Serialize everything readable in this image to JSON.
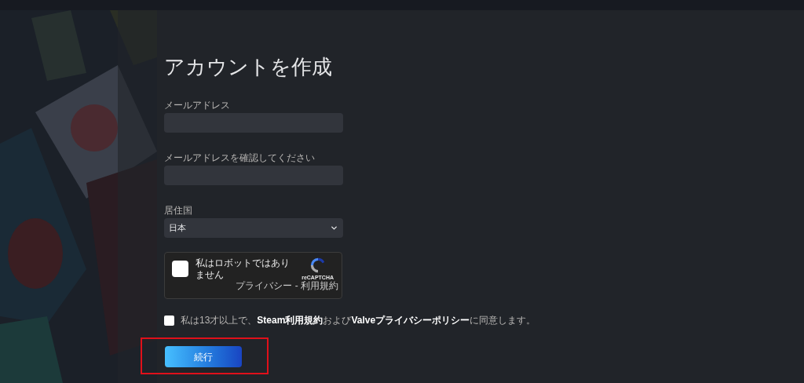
{
  "title": "アカウントを作成",
  "fields": [
    {
      "kind": "text",
      "label": "メールアドレス"
    },
    {
      "kind": "text",
      "label": "メールアドレスを確認してください"
    },
    {
      "kind": "select",
      "label": "居住国",
      "value": "日本"
    }
  ],
  "captcha": {
    "checked": false,
    "label": "私はロボットではありません",
    "brand": "reCAPTCHA",
    "links": "プライバシー - 利用規約"
  },
  "agreement": {
    "checked": false,
    "text": "私は13才以上で、**Steam利用規約**および**Valveプライバシーポリシー**に同意します。"
  },
  "continue_button": {
    "label": "続行",
    "highlighted": true
  }
}
